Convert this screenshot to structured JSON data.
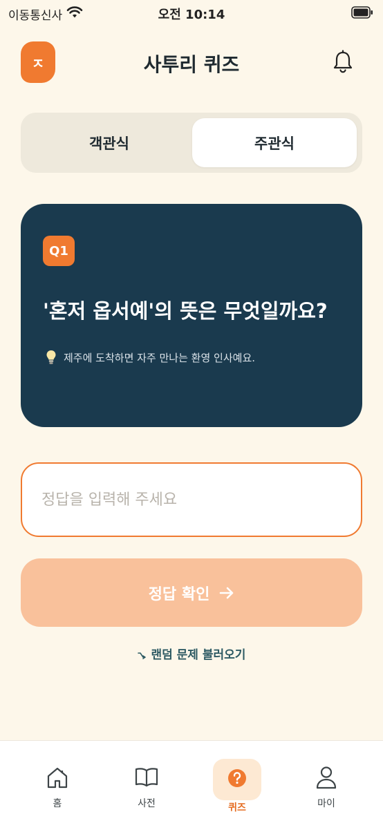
{
  "status_bar": {
    "carrier": "이동통신사",
    "time": "오전 10:14"
  },
  "header": {
    "logo_letter": "ㅈ",
    "title": "사투리 퀴즈",
    "bell_icon": "bell-icon"
  },
  "tabs": [
    {
      "label": "객관식",
      "selected": false
    },
    {
      "label": "주관식",
      "selected": true
    }
  ],
  "question": {
    "badge": "Q1",
    "text": "'혼저 옵서예'의 뜻은 무엇일까요?",
    "hint": "제주에 도착하면 자주 만나는 환영 인사예요."
  },
  "answer": {
    "placeholder": "정답을 입력해 주세요",
    "value": ""
  },
  "submit": {
    "label": "정답 확인"
  },
  "random_link": {
    "label": "랜덤 문제 불러오기"
  },
  "bottom_nav": [
    {
      "label": "홈",
      "icon": "home-icon"
    },
    {
      "label": "사전",
      "icon": "book-icon"
    },
    {
      "label": "퀴즈",
      "icon": "question-icon",
      "active": true
    },
    {
      "label": "마이",
      "icon": "user-icon"
    }
  ],
  "colors": {
    "background": "#FDF7EA",
    "accent": "#F07A30",
    "card": "#1A3A4E",
    "button_disabled": "#F9C19B",
    "link": "#2D5A63"
  }
}
